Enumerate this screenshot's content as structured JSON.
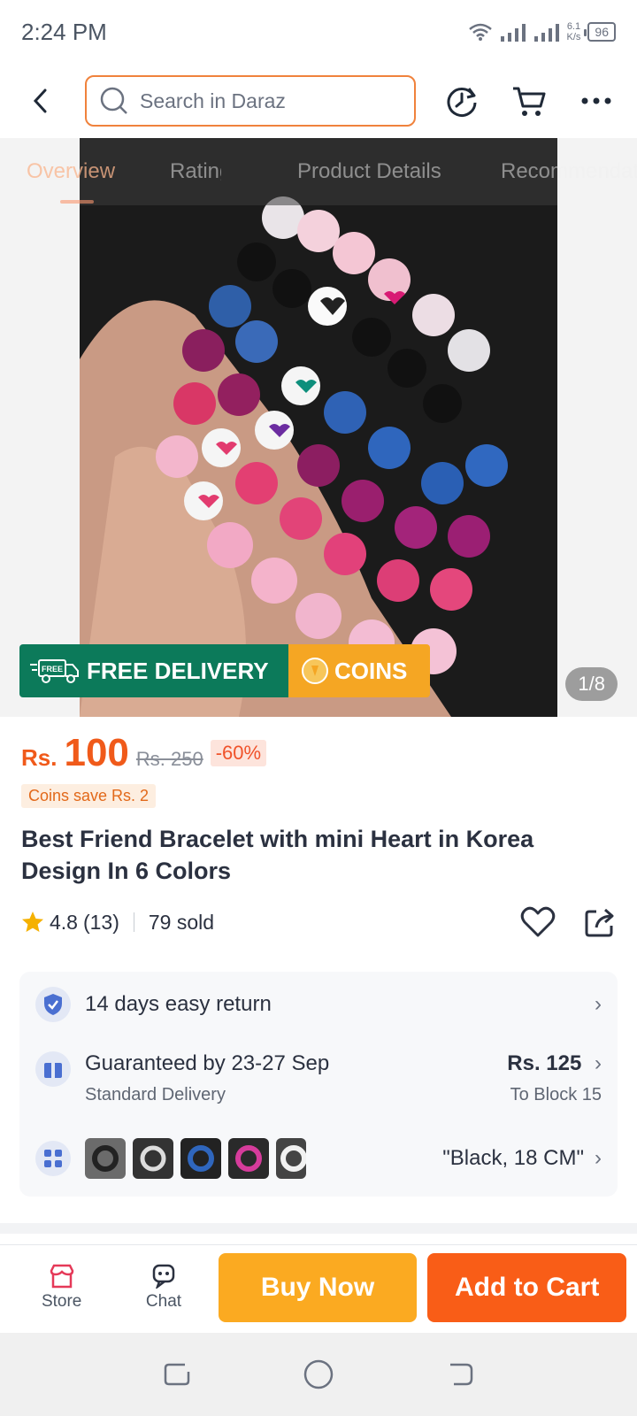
{
  "status_bar": {
    "time": "2:24 PM",
    "net_speed_value": "6.1",
    "net_speed_unit": "K/s",
    "battery": "96"
  },
  "search": {
    "placeholder": "Search in Daraz"
  },
  "tabs": [
    {
      "label": "Overview"
    },
    {
      "label": "Ratings"
    },
    {
      "label": "Product Details"
    },
    {
      "label": "Recommendations"
    }
  ],
  "hero": {
    "page_indicator": "1/8"
  },
  "promo": {
    "delivery_label": "FREE DELIVERY",
    "free_badge": "FREE",
    "coins_label": "COINS"
  },
  "price": {
    "currency": "Rs.",
    "current": "100",
    "original": "Rs. 250",
    "discount": "-60%",
    "coins_save": "Coins save Rs. 2"
  },
  "product": {
    "title": "Best Friend Bracelet with mini Heart in Korea Design In 6 Colors"
  },
  "rating": {
    "score": "4.8",
    "count": "(13)",
    "sold": "79 sold"
  },
  "info": {
    "return": "14 days easy return",
    "delivery_title": "Guaranteed by 23-27 Sep",
    "delivery_type": "Standard Delivery",
    "delivery_price": "Rs. 125",
    "delivery_location": "To Block 15",
    "variant_selected": "\"Black, 18 CM\""
  },
  "actions": {
    "store": "Store",
    "chat": "Chat",
    "buy_now": "Buy Now",
    "add_to_cart": "Add to Cart"
  },
  "colors": {
    "accent": "#f95d17",
    "buy": "#fbaa21",
    "delivery_green": "#0c7a5a",
    "coins_orange": "#f5a623"
  }
}
